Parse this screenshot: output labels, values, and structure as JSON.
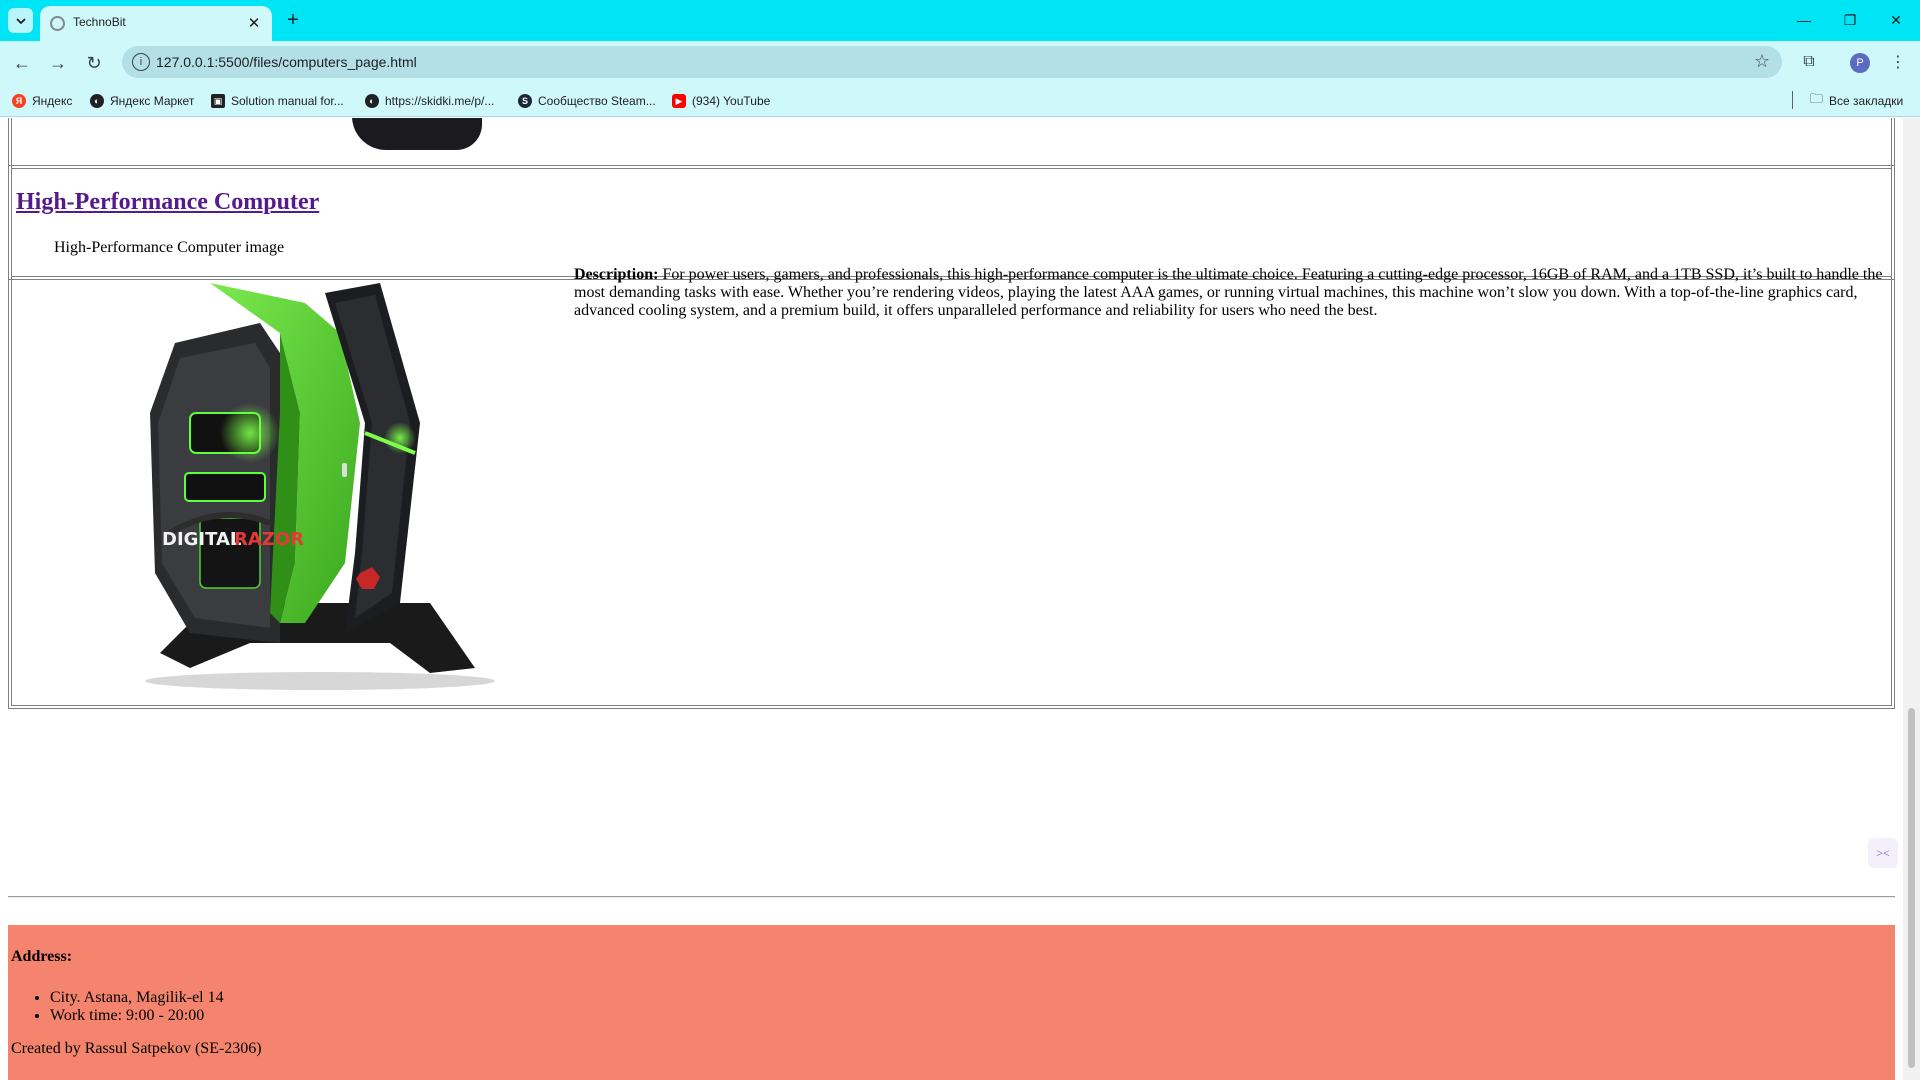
{
  "browser": {
    "tab_title": "TechnoBit",
    "tab_close": "✕",
    "new_tab": "+",
    "url": "127.0.0.1:5500/files/computers_page.html",
    "profile_initial": "P",
    "bookmarks": [
      {
        "label": "Яндекс",
        "icon": "yandex-icon",
        "color": "#fc3f1d"
      },
      {
        "label": "Яндекс Маркет",
        "icon": "globe-icon",
        "color": "#202124"
      },
      {
        "label": "Solution manual for...",
        "icon": "site-icon",
        "color": "#202124"
      },
      {
        "label": "https://skidki.me/p/...",
        "icon": "globe-icon",
        "color": "#202124"
      },
      {
        "label": "Сообщество Steam...",
        "icon": "steam-icon",
        "color": "#1b2838"
      },
      {
        "label": "(934) YouTube",
        "icon": "youtube-icon",
        "color": "#ff0000"
      }
    ],
    "all_bookmarks": "Все закладки"
  },
  "product": {
    "title": "High-Performance Computer",
    "image_alt": "High-Performance Computer image",
    "image_brand": "DIGITAL",
    "image_brand_accent": "RAZOR",
    "description_label": "Description:",
    "description": " For power users, gamers, and professionals, this high-performance computer is the ultimate choice. Featuring a cutting-edge processor, 16GB of RAM, and a 1TB SSD, it’s built to handle the most demanding tasks with ease. Whether you’re rendering videos, playing the latest AAA games, or running virtual machines, this machine won’t slow you down. With a top-of-the-line graphics card, advanced cooling system, and a premium build, it offers unparalleled performance and reliability for users who need the best."
  },
  "footer": {
    "address_label": "Address:",
    "items": [
      "City. Astana, Magilik-el 14",
      "Work time: 9:00 - 20:00"
    ],
    "credit": "Created by Rassul Satpekov (SE-2306)",
    "background": "#f4846d"
  },
  "colors": {
    "tabbar": "#00e5f5",
    "toolbar": "#cff8fb",
    "link_visited": "#551a8b",
    "case_green": "#5fd33a"
  }
}
